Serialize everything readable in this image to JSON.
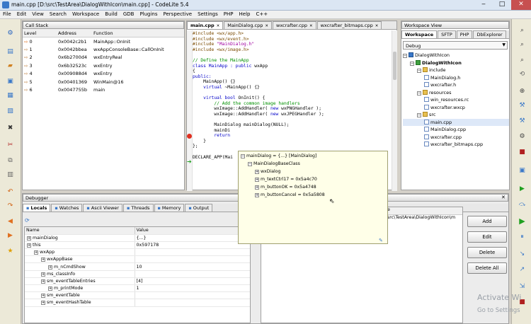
{
  "window": {
    "title": "main.cpp [D:\\src\\TestArea\\DialogWithIcon\\main.cpp] - CodeLite 5.4",
    "min": "‒",
    "max": "□",
    "close": "✕"
  },
  "menu": [
    "File",
    "Edit",
    "View",
    "Search",
    "Workspace",
    "Build",
    "GDB",
    "Plugins",
    "Perspective",
    "Settings",
    "PHP",
    "Help",
    "C++"
  ],
  "callstack": {
    "title": "Call Stack",
    "headers": [
      "Level",
      "Address",
      "Function"
    ],
    "rows": [
      [
        "0",
        "0x0042c2b1",
        "MainApp::OnInit"
      ],
      [
        "1",
        "0x0042bbea",
        "wxAppConsoleBase::CallOnInit"
      ],
      [
        "2",
        "0x6b2700d4",
        "wxEntryReal"
      ],
      [
        "3",
        "0x6b32523c",
        "wxEntry"
      ],
      [
        "4",
        "0x009088d4",
        "wxEntry"
      ],
      [
        "5",
        "0x00401369",
        "WinMain@16"
      ],
      [
        "6",
        "0x0047755b",
        "main"
      ]
    ]
  },
  "editor": {
    "tabs": [
      "main.cpp",
      "MainDialog.cpp",
      "wxcrafter.cpp",
      "wxcrafter_bitmaps.cpp"
    ],
    "lines": [
      [
        [
          "#include ",
          "pp"
        ],
        [
          "<wx/app.h>",
          "pp"
        ]
      ],
      [
        [
          "#include ",
          "pp"
        ],
        [
          "<wx/event.h>",
          "pp"
        ]
      ],
      [
        [
          "#include ",
          "pp"
        ],
        [
          "\"MainDialog.h\"",
          "st"
        ]
      ],
      [
        [
          "#include ",
          "pp"
        ],
        [
          "<wx/image.h>",
          "pp"
        ]
      ],
      [],
      [
        [
          "// Define the MainApp",
          "cm"
        ]
      ],
      [
        [
          "class ",
          "kw"
        ],
        [
          "MainApp : ",
          "kw"
        ],
        [
          "public ",
          "kw"
        ],
        [
          "wxApp",
          ""
        ]
      ],
      [
        [
          "{",
          ""
        ]
      ],
      [
        [
          "public:",
          "kw"
        ]
      ],
      [
        [
          "    MainApp() {}",
          ""
        ]
      ],
      [
        [
          "    ",
          ""
        ],
        [
          "virtual ",
          "kw"
        ],
        [
          "~MainApp() {}",
          ""
        ]
      ],
      [],
      [
        [
          "    ",
          ""
        ],
        [
          "virtual ",
          "kw"
        ],
        [
          "bool ",
          "kw"
        ],
        [
          "OnInit() {",
          ""
        ]
      ],
      [
        [
          "        // Add the common image handlers",
          "cm"
        ]
      ],
      [
        [
          "        wxImage::AddHandler( ",
          ""
        ],
        [
          "new ",
          "kw"
        ],
        [
          "wxPNGHandler );",
          ""
        ]
      ],
      [
        [
          "        wxImage::AddHandler( ",
          ""
        ],
        [
          "new ",
          "kw"
        ],
        [
          "wxJPEGHandler );",
          ""
        ]
      ],
      [],
      [
        [
          "        MainDialog mainDialog(NULL);",
          ""
        ]
      ],
      [
        [
          "        mainDi",
          ""
        ]
      ],
      [
        [
          "        return ",
          "kw"
        ]
      ],
      [
        [
          "    }",
          ""
        ]
      ],
      [
        [
          "};",
          ""
        ]
      ],
      [],
      [
        [
          "DECLARE_APP(Mai",
          ""
        ]
      ]
    ]
  },
  "tooltip": {
    "root": "mainDialog = {...} [MainDialog]",
    "items": [
      "MainDialogBaseClass",
      "wxDialog",
      "m_textCtrl17 = 0x5a4c70",
      "m_buttonOK = 0x5a4748",
      "m_buttonCancel = 0x5a5808"
    ]
  },
  "workspace": {
    "title": "Workspace View",
    "tabs": [
      "Workspace",
      "SFTP",
      "PHP",
      "DbExplorer"
    ],
    "config": "Debug",
    "tree": [
      [
        "DialogWithIcon",
        0,
        "ws"
      ],
      [
        "DialogWithIcon",
        1,
        "proj"
      ],
      [
        "include",
        2,
        "folder"
      ],
      [
        "MainDialog.h",
        3,
        "file"
      ],
      [
        "wxcrafter.h",
        3,
        "file"
      ],
      [
        "resources",
        2,
        "folder"
      ],
      [
        "win_resources.rc",
        3,
        "file"
      ],
      [
        "wxcrafter.wxcp",
        3,
        "file"
      ],
      [
        "src",
        2,
        "folder"
      ],
      [
        "main.cpp",
        3,
        "file"
      ],
      [
        "MainDialog.cpp",
        3,
        "file"
      ],
      [
        "wxcrafter.cpp",
        3,
        "file"
      ],
      [
        "wxcrafter_bitmaps.cpp",
        3,
        "file"
      ]
    ]
  },
  "debugger": {
    "title": "Debugger",
    "tabs": [
      "Locals",
      "Watches",
      "Ascii Viewer",
      "Threads",
      "Memory",
      "Output"
    ],
    "headers": [
      "Name",
      "Value"
    ],
    "rows": [
      [
        "mainDialog",
        "{...}",
        0
      ],
      [
        "this",
        "0x597178",
        0
      ],
      [
        "wxApp",
        "",
        1
      ],
      [
        "wxAppBase",
        "",
        2
      ],
      [
        "m_nCmdShow",
        "10",
        3
      ],
      [
        "ms_classInfo",
        "",
        2
      ],
      [
        "sm_eventTableEntries",
        "[4]",
        2
      ],
      [
        "m_printMode",
        "1",
        3
      ],
      [
        "sm_eventTable",
        "",
        2
      ],
      [
        "sm_eventHashTable",
        "",
        2
      ]
    ]
  },
  "watch_fragment": {
    "header": "e",
    "path": "src\\TestArea\\DialogWithIcon\\m"
  },
  "buttons": [
    "Add",
    "Edit",
    "Delete",
    "Delete All"
  ],
  "watermark": {
    "line1": "Activate Wi",
    "line2": "Go to Settings"
  }
}
